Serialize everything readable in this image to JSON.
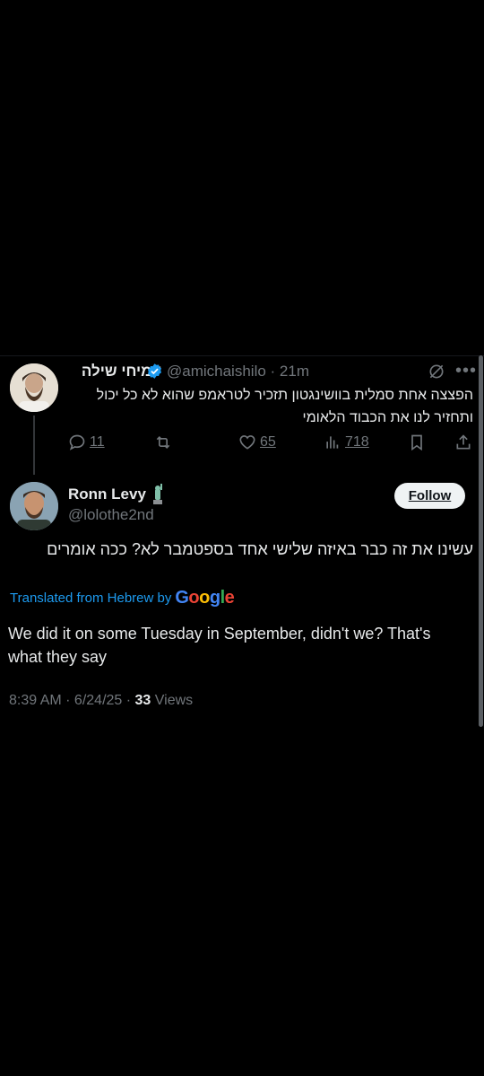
{
  "reply_to": {
    "display_name": "עמיחי שילה",
    "handle": "@amichaishilo",
    "time": "21m",
    "text": "הפצצה אחת סמלית בוושינגטון תזכיר לטראמפ שהוא לא כל יכול ותחזיר לנו את הכבוד הלאומי",
    "replies": "11",
    "likes": "65",
    "views": "718",
    "icons": [
      "verified-badge-icon",
      "grok-icon",
      "more-icon",
      "reply-icon",
      "retweet-icon",
      "like-icon",
      "views-icon",
      "bookmark-icon",
      "share-icon"
    ]
  },
  "tweet": {
    "display_name": "Ronn Levy",
    "handle": "@lolothe2nd",
    "follow_label": "Follow",
    "text": "עשינו את זה כבר באיזה שלישי אחד בספטמבר לא? ככה אומרים",
    "translated_prefix": "Translated from Hebrew by",
    "translator": "Google",
    "translation": "We did it on some Tuesday in September, didn't we? That's what they say",
    "timestamp": "8:39 AM · 6/24/25 · ",
    "view_count": "33",
    "views_label": " Views"
  },
  "colors": {
    "background": "#000000",
    "text": "#e7e9ea",
    "muted": "#71767b",
    "link": "#1d9bf0",
    "verified": "#1d9bf0"
  }
}
